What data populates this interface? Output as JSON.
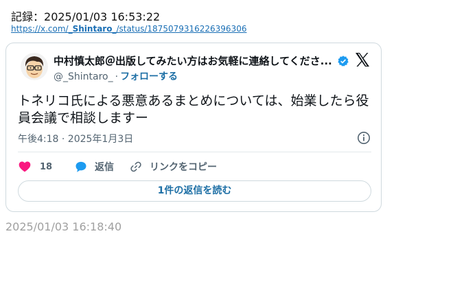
{
  "record": {
    "label": "記録：",
    "datetime": "2025/01/03 16:53:22"
  },
  "url": {
    "prefix": "https://x.com/",
    "username": "_Shintaro_",
    "suffix": "/status/1875079316226396306"
  },
  "tweet": {
    "display_name": "中村慎太郎＠出版してみたい方はお気軽に連絡してくださ...",
    "handle": "@_Shintaro_",
    "separator": "·",
    "follow_label": "フォローする",
    "text": "トネリコ氏による悪意あるまとめについては、始業したら役員会議で相談しますー",
    "time": "午後4:18 · 2025年1月3日",
    "like_count": "18",
    "reply_label": "返信",
    "copy_link_label": "リンクをコピー",
    "read_replies_label": "1件の返信を読む"
  },
  "footer_timestamp": "2025/01/03 16:18:40",
  "colors": {
    "like": "#f91880",
    "reply": "#1d9bf0",
    "verified": "#1d9bf0",
    "link": "#1d6fa5",
    "muted": "#536471"
  }
}
